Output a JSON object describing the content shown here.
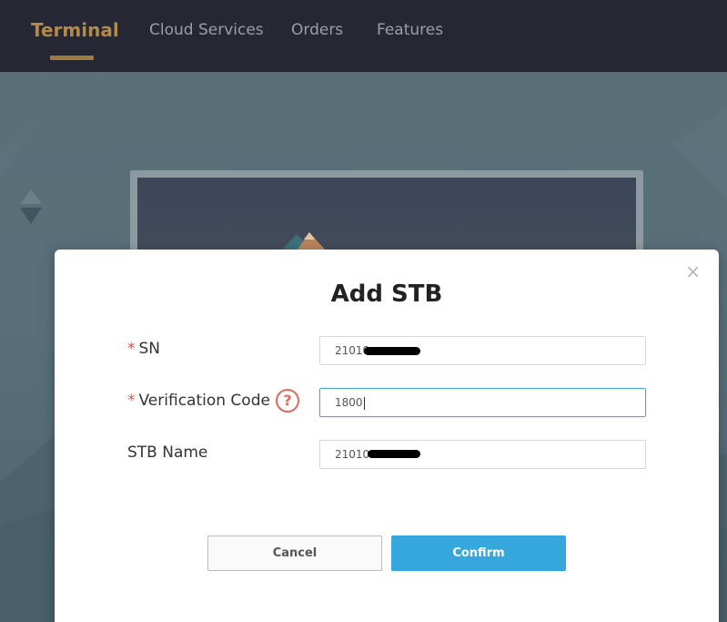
{
  "nav": {
    "items": [
      {
        "label": "Terminal"
      },
      {
        "label": "Cloud Services"
      },
      {
        "label": "Orders"
      },
      {
        "label": "Features"
      }
    ]
  },
  "modal": {
    "title": "Add STB",
    "close_icon": "×",
    "fields": {
      "sn": {
        "label": "SN",
        "required_mark": "*",
        "value": "21010"
      },
      "verification_code": {
        "label": "Verification Code",
        "required_mark": "*",
        "value": "1800",
        "help_icon": "?"
      },
      "stb_name": {
        "label": "STB Name",
        "value": "21010"
      }
    },
    "buttons": {
      "cancel": "Cancel",
      "confirm": "Confirm"
    }
  },
  "colors": {
    "nav_bg": "#252733",
    "nav_active": "#b48a4a",
    "confirm_bg": "#36a7dc",
    "required": "#e2554b"
  }
}
